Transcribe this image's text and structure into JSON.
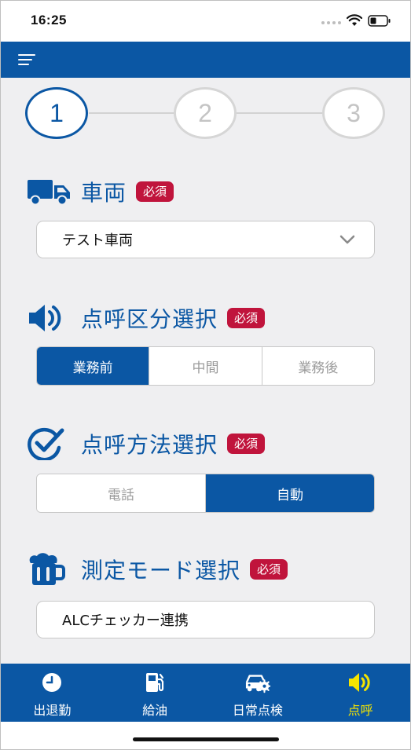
{
  "status_bar": {
    "time": "16:25"
  },
  "stepper": {
    "steps": [
      "1",
      "2",
      "3"
    ],
    "current_step": 1
  },
  "vehicle": {
    "title": "車両",
    "required": "必須",
    "selected": "テスト車両",
    "icon": "truck-icon"
  },
  "rollcall_category": {
    "title": "点呼区分選択",
    "required": "必須",
    "options": [
      "業務前",
      "中間",
      "業務後"
    ],
    "selected_index": 0,
    "icon": "speaker-icon"
  },
  "rollcall_method": {
    "title": "点呼方法選択",
    "required": "必須",
    "options": [
      "電話",
      "自動"
    ],
    "selected_index": 1,
    "icon": "check-circle-icon"
  },
  "measure_mode": {
    "title": "測定モード選択",
    "required": "必須",
    "selected": "ALCチェッカー連携",
    "icon": "beer-mug-icon"
  },
  "bottom_nav": {
    "items": [
      {
        "label": "出退勤",
        "icon": "clock-icon"
      },
      {
        "label": "給油",
        "icon": "fuel-pump-icon"
      },
      {
        "label": "日常点検",
        "icon": "car-gear-icon"
      },
      {
        "label": "点呼",
        "icon": "speaker-icon"
      }
    ],
    "active_index": 3
  },
  "colors": {
    "primary": "#0b57a4",
    "required_badge": "#c0143c",
    "active_nav_label": "#f4e400",
    "background": "#efeff1"
  }
}
